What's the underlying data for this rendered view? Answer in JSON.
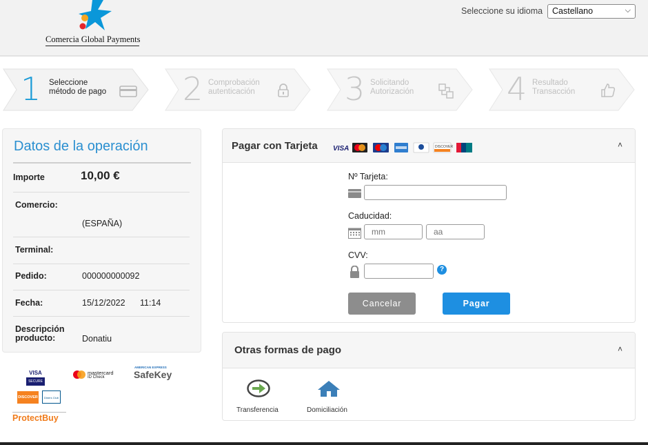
{
  "header": {
    "logo_text": "Comercia Global Payments",
    "language_label": "Seleccione su idioma",
    "language_selected": "Castellano"
  },
  "steps": [
    {
      "number": "1",
      "text": "Seleccione\nmétodo de pago",
      "icon": "credit-card-icon",
      "active": true
    },
    {
      "number": "2",
      "text": "Comprobación\nautenticación",
      "icon": "lock-icon",
      "active": false
    },
    {
      "number": "3",
      "text": "Solicitando\nAutorización",
      "icon": "transfer-icon",
      "active": false
    },
    {
      "number": "4",
      "text": "Resultado\nTransacción",
      "icon": "thumbs-up-icon",
      "active": false
    }
  ],
  "operation": {
    "title": "Datos de la operación",
    "amount_label": "Importe",
    "amount_value": "10,00 €",
    "merchant_label": "Comercio:",
    "merchant_value": "(ESPAÑA)",
    "terminal_label": "Terminal:",
    "order_label": "Pedido:",
    "order_value": "000000000092",
    "date_label": "Fecha:",
    "date_value": "15/12/2022",
    "time_value": "11:14",
    "description_label": "Descripción\nproducto:",
    "description_value": "Donatiu"
  },
  "security": {
    "visa_top": "VISA",
    "visa_bottom": "SECURE",
    "mastercard_line1": "mastercard",
    "mastercard_line2": "ID Check",
    "amex_line1": "AMERICAN EXPRESS",
    "amex_line2": "SafeKey",
    "discover": "DISCOVER",
    "diners": "Diners Club",
    "protectbuy": "ProtectBuy"
  },
  "card_payment": {
    "title": "Pagar con Tarjeta",
    "brands": [
      "VISA",
      "Mastercard",
      "Maestro",
      "American Express",
      "Diners",
      "Discover",
      "UnionPay"
    ],
    "card_number_label": "Nº Tarjeta:",
    "expiry_label": "Caducidad:",
    "month_placeholder": "mm",
    "year_placeholder": "aa",
    "cvv_label": "CVV:",
    "help_symbol": "?",
    "cancel_label": "Cancelar",
    "pay_label": "Pagar",
    "accent_color": "#1e8fe1"
  },
  "other_payments": {
    "title": "Otras formas de pago",
    "methods": [
      {
        "label": "Transferencia",
        "icon": "arrow-circle-icon"
      },
      {
        "label": "Domiciliación",
        "icon": "house-icon"
      }
    ]
  }
}
